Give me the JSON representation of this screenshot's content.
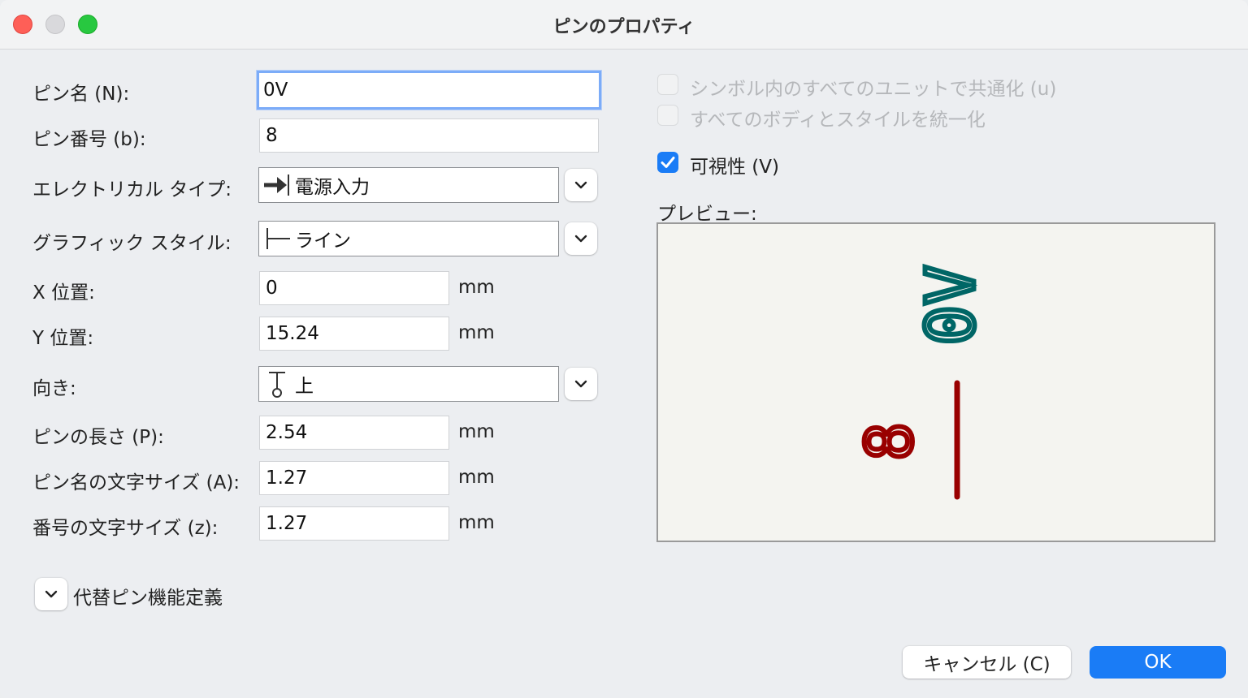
{
  "window": {
    "title": "ピンのプロパティ"
  },
  "form": {
    "pin_name": {
      "label": "ピン名 (N):",
      "value": "0V"
    },
    "pin_number": {
      "label": "ピン番号 (b):",
      "value": "8"
    },
    "electrical_type": {
      "label": "エレクトリカル タイプ:",
      "value": "電源入力",
      "icon": "power-input-arrow-icon"
    },
    "graphic_style": {
      "label": "グラフィック スタイル:",
      "value": "ライン",
      "icon": "line-style-icon"
    },
    "x_position": {
      "label": "X 位置:",
      "value": "0",
      "unit": "mm"
    },
    "y_position": {
      "label": "Y 位置:",
      "value": "15.24",
      "unit": "mm"
    },
    "orientation": {
      "label": "向き:",
      "value": "上",
      "icon": "pin-up-icon"
    },
    "pin_length": {
      "label": "ピンの長さ (P):",
      "value": "2.54",
      "unit": "mm"
    },
    "name_text_size": {
      "label": "ピン名の文字サイズ (A):",
      "value": "1.27",
      "unit": "mm"
    },
    "number_text_size": {
      "label": "番号の文字サイズ (z):",
      "value": "1.27",
      "unit": "mm"
    },
    "alternate_pins": {
      "label": "代替ピン機能定義",
      "icon": "chevron-down-icon"
    }
  },
  "options": {
    "common_units": {
      "label": "シンボル内のすべてのユニットで共通化 (u)",
      "checked": false,
      "enabled": false
    },
    "common_styles": {
      "label": "すべてのボディとスタイルを統一化",
      "checked": false,
      "enabled": false
    },
    "visible": {
      "label": "可視性 (V)",
      "checked": true,
      "enabled": true
    }
  },
  "preview": {
    "label": "プレビュー:",
    "pin_name_text": "0V",
    "pin_number_text": "8",
    "name_color": "#006666",
    "pin_color": "#990000"
  },
  "buttons": {
    "cancel": "キャンセル (C)",
    "ok": "OK"
  },
  "colors": {
    "accent": "#1a7cf6"
  }
}
